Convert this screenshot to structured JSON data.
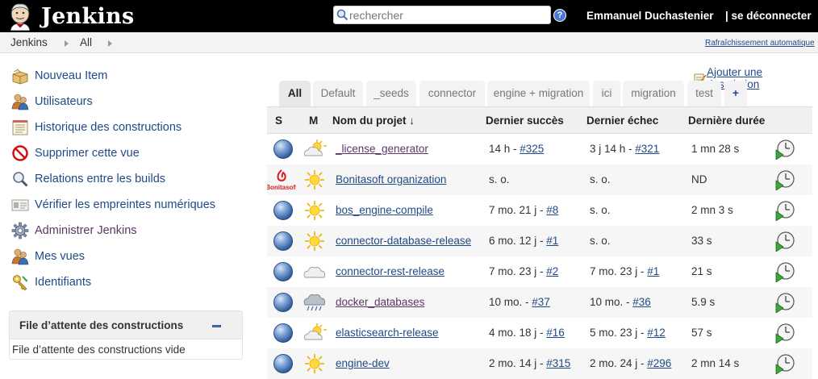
{
  "header": {
    "brand": "Jenkins",
    "search_placeholder": "rechercher",
    "user_name": "Emmanuel Duchastenier",
    "logout_label": "| se déconnecter"
  },
  "breadcrumb": {
    "items": [
      "Jenkins",
      "All"
    ],
    "auto_refresh": "Rafraîchissement automatique"
  },
  "sidebar": {
    "items": [
      {
        "label": "Nouveau Item",
        "icon": "new-package-icon"
      },
      {
        "label": "Utilisateurs",
        "icon": "users-icon"
      },
      {
        "label": "Historique des constructions",
        "icon": "notepad-icon"
      },
      {
        "label": "Supprimer cette vue",
        "icon": "no-entry-icon"
      },
      {
        "label": "Relations entre les builds",
        "icon": "magnifier-icon"
      },
      {
        "label": "Vérifier les empreintes numériques",
        "icon": "fingerprint-card-icon"
      },
      {
        "label": "Administrer Jenkins",
        "icon": "gear-icon"
      },
      {
        "label": "Mes vues",
        "icon": "users-icon"
      },
      {
        "label": "Identifiants",
        "icon": "keys-icon"
      }
    ],
    "queue": {
      "title": "File d’attente des constructions",
      "empty": "File d’attente des constructions vide"
    }
  },
  "main": {
    "add_description": "Ajouter une description",
    "tabs": [
      "All",
      "Default",
      "_seeds",
      "connector",
      "engine + migration",
      "ici",
      "migration",
      "test",
      "+"
    ],
    "active_tab": "All",
    "columns": {
      "s": "S",
      "m": "M",
      "name": "Nom du projet  ↓",
      "last_success": "Dernier succès",
      "last_failure": "Dernier échec",
      "last_duration": "Dernière durée"
    },
    "rows": [
      {
        "name": "_license_generator",
        "weather": "sun-cloud-icon",
        "success": "14 h - ",
        "success_build": "#325",
        "failure": "3 j 14 h - ",
        "failure_build": "#321",
        "duration": "1 mn 28 s"
      },
      {
        "name": "Bonitasoft organization",
        "weather": "sun-icon",
        "success": "s. o.",
        "success_build": "",
        "failure": "s. o.",
        "failure_build": "",
        "duration": "ND"
      },
      {
        "name": "bos_engine-compile",
        "weather": "sun-icon",
        "success": "7 mo. 21 j - ",
        "success_build": "#8",
        "failure": "s. o.",
        "failure_build": "",
        "duration": "2 mn 3 s"
      },
      {
        "name": "connector-database-release",
        "weather": "sun-icon",
        "success": "6 mo. 12 j - ",
        "success_build": "#1",
        "failure": "s. o.",
        "failure_build": "",
        "duration": "33 s"
      },
      {
        "name": "connector-rest-release",
        "weather": "cloud-icon",
        "success": "7 mo. 23 j - ",
        "success_build": "#2",
        "failure": "7 mo. 23 j - ",
        "failure_build": "#1",
        "duration": "21 s"
      },
      {
        "name": "docker_databases",
        "weather": "rain-icon",
        "success": "10 mo. - ",
        "success_build": "#37",
        "failure": "10 mo. - ",
        "failure_build": "#36",
        "duration": "5.9 s"
      },
      {
        "name": "elasticsearch-release",
        "weather": "sun-cloud-icon",
        "success": "4 mo. 18 j - ",
        "success_build": "#16",
        "failure": "5 mo. 23 j - ",
        "failure_build": "#12",
        "duration": "57 s"
      },
      {
        "name": "engine-dev",
        "weather": "sun-icon",
        "success": "2 mo. 14 j - ",
        "success_build": "#315",
        "failure": "2 mo. 24 j - ",
        "failure_build": "#296",
        "duration": "2 mn 14 s"
      }
    ]
  },
  "colors": {
    "header_bg": "#000000",
    "link": "#204a87",
    "visited_link": "#5c3566",
    "ball_blue": "#2f5a9a"
  }
}
